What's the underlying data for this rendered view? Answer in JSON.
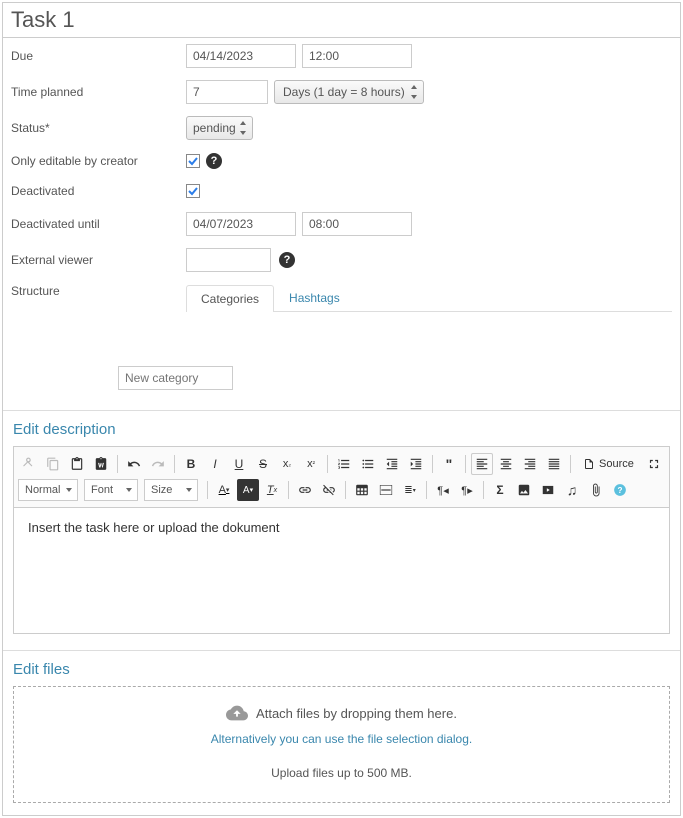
{
  "title": "Task 1",
  "labels": {
    "due": "Due",
    "time_planned": "Time planned",
    "status": "Status*",
    "only_editable": "Only editable by creator",
    "deactivated": "Deactivated",
    "deactivated_until": "Deactivated until",
    "external_viewer": "External viewer",
    "structure": "Structure"
  },
  "values": {
    "due_date": "04/14/2023",
    "due_time": "12:00",
    "time_planned": "7",
    "time_unit": "Days (1 day = 8 hours)",
    "status": "pending",
    "only_editable_checked": true,
    "deactivated_checked": true,
    "deactivated_date": "04/07/2023",
    "deactivated_time": "08:00",
    "external_viewer": ""
  },
  "structure_tabs": {
    "categories": "Categories",
    "hashtags": "Hashtags"
  },
  "new_category_placeholder": "New category",
  "sections": {
    "edit_description": "Edit description",
    "edit_files": "Edit files"
  },
  "editor": {
    "format_normal": "Normal",
    "format_font": "Font",
    "format_size": "Size",
    "source": "Source",
    "content": "Insert the task here or upload the dokument"
  },
  "dropzone": {
    "line1": "Attach files by dropping them here.",
    "link": "Alternatively you can use the file selection dialog",
    "note": "Upload files up to 500 MB."
  }
}
